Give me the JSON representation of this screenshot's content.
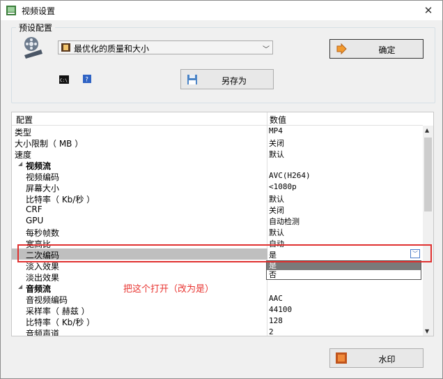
{
  "window": {
    "title": "视频设置",
    "close": "✕"
  },
  "preset": {
    "group_label": "预设配置",
    "selected": "最优化的质量和大小",
    "ok_label": "确定",
    "save_as_label": "另存为"
  },
  "table": {
    "headers": {
      "name": "配置",
      "value": "数值"
    },
    "rows": [
      {
        "name": "类型",
        "value": "MP4"
      },
      {
        "name": "大小限制（ MB ）",
        "value": "关闭"
      },
      {
        "name": "速度",
        "value": "默认"
      },
      {
        "name": "视频流",
        "value": ""
      },
      {
        "name": "视频编码",
        "value": "AVC(H264)"
      },
      {
        "name": "屏幕大小",
        "value": "<1080p"
      },
      {
        "name": "比特率（ Kb/秒 ）",
        "value": "默认"
      },
      {
        "name": "CRF",
        "value": "关闭"
      },
      {
        "name": "GPU",
        "value": "自动检测"
      },
      {
        "name": "每秒帧数",
        "value": "默认"
      },
      {
        "name": "宽高比",
        "value": "自动"
      },
      {
        "name": "二次编码",
        "value": "是"
      },
      {
        "name": "淡入效果",
        "value": ""
      },
      {
        "name": "淡出效果",
        "value": ""
      },
      {
        "name": "音频流",
        "value": ""
      },
      {
        "name": "音视频编码",
        "value": "AAC"
      },
      {
        "name": "采样率（ 赫兹 ）",
        "value": "44100"
      },
      {
        "name": "比特率（ Kb/秒 ）",
        "value": "128"
      },
      {
        "name": "音频声道",
        "value": "2"
      }
    ]
  },
  "dropdown": {
    "options": [
      "是",
      "否"
    ],
    "selected": "是"
  },
  "annotation": "把这个打开（改为是）",
  "watermark_label": "水印",
  "colors": {
    "highlight": "#e0302f",
    "annotation": "#e8332f",
    "selected_row": "#bfbfbf"
  }
}
